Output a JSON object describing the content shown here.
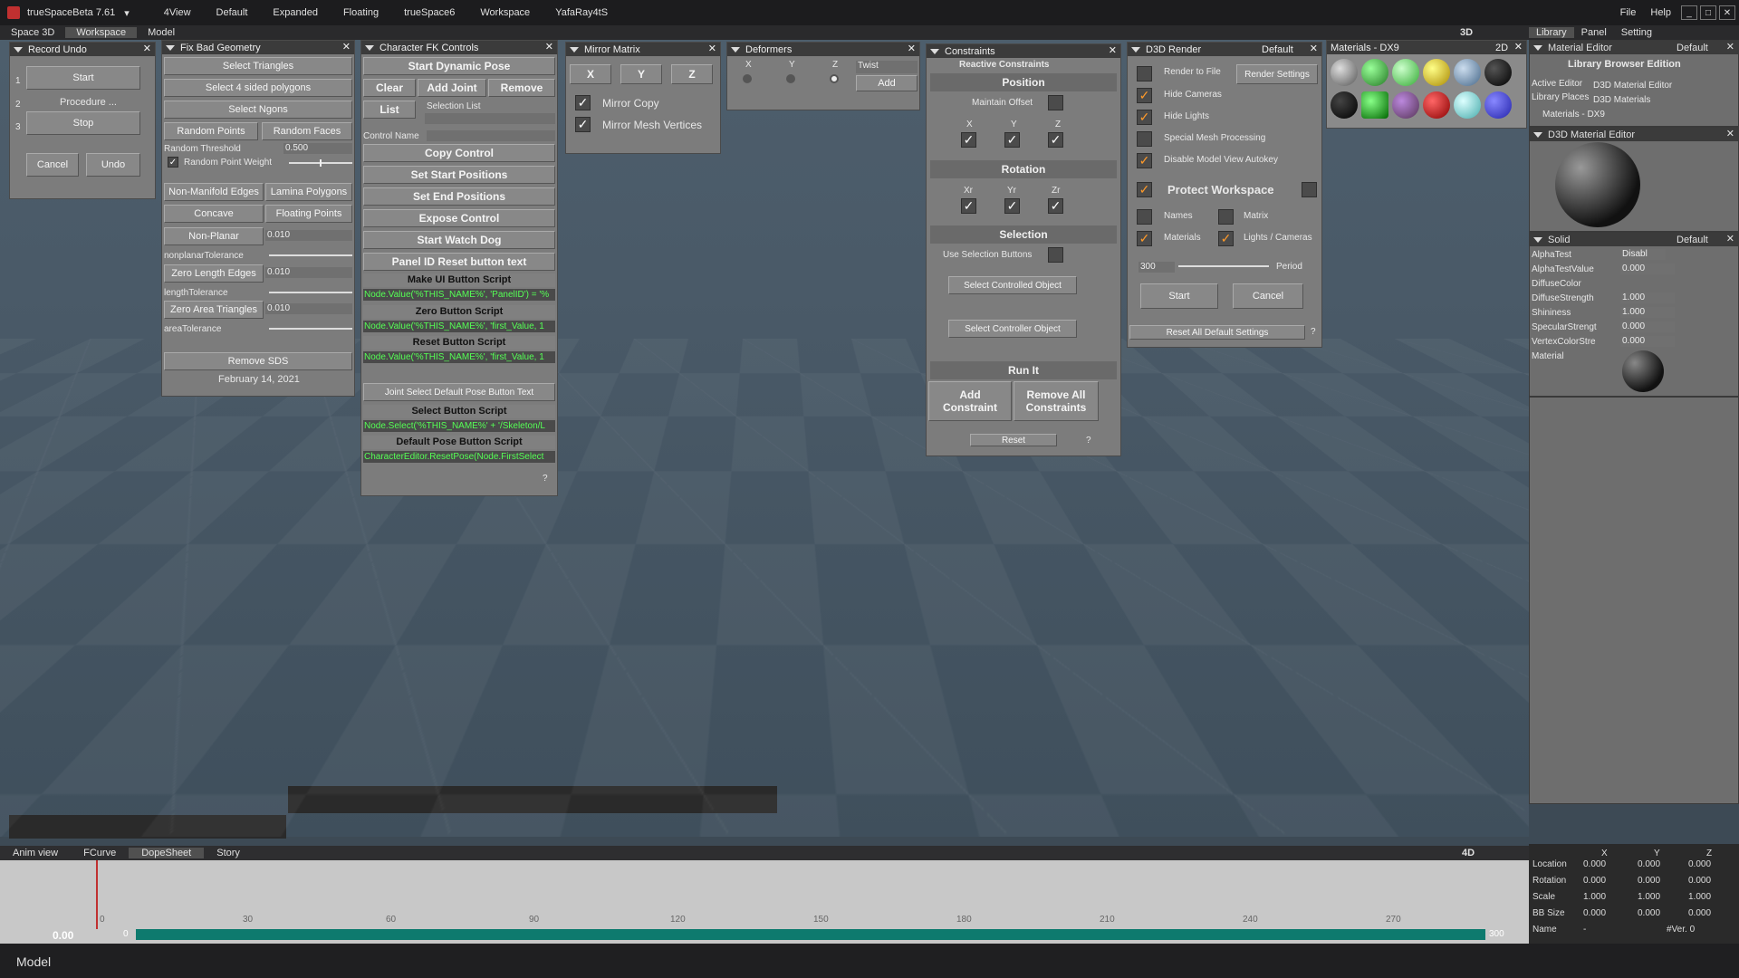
{
  "app": {
    "title": "trueSpaceBeta 7.61",
    "menu": [
      "4View",
      "Default",
      "Expanded",
      "Floating",
      "trueSpace6",
      "Workspace",
      "YafaRay4tS"
    ],
    "right_menu": [
      "File",
      "Help"
    ]
  },
  "tabs": [
    "Space 3D",
    "Workspace",
    "Model"
  ],
  "right_tabs": [
    "Library",
    "Panel",
    "Setting"
  ],
  "record_undo": {
    "title": "Record Undo",
    "start": "Start",
    "procedure": "Procedure ...",
    "stop": "Stop",
    "cancel": "Cancel",
    "undo": "Undo",
    "nums": [
      "1",
      "2",
      "3"
    ]
  },
  "fix_geom": {
    "title": "Fix Bad Geometry",
    "b1": "Select Triangles",
    "b2": "Select 4 sided polygons",
    "b3": "Select Ngons",
    "b4": "Random Points",
    "b5": "Random Faces",
    "thresh_label": "Random Threshold",
    "thresh_val": "0.500",
    "weight_label": "Random Point Weight",
    "b6": "Non-Manifold Edges",
    "b7": "Lamina Polygons",
    "b8": "Concave",
    "b9": "Floating Points",
    "b10": "Non-Planar",
    "np_val": "0.010",
    "np_tol": "nonplanarTolerance",
    "b11": "Zero Length Edges",
    "zl_val": "0.010",
    "len_tol": "lengthTolerance",
    "b12": "Zero Area Triangles",
    "za_val": "0.010",
    "area_tol": "areaTolerance",
    "b13": "Remove SDS",
    "date": "February 14, 2021"
  },
  "char_fk": {
    "title": "Character FK Controls",
    "start_pose": "Start Dynamic Pose",
    "clear": "Clear",
    "add": "Add Joint",
    "remove": "Remove",
    "list": "List",
    "sel_list": "Selection List",
    "control_name": "Control Name",
    "copy": "Copy Control",
    "set_start": "Set Start Positions",
    "set_end": "Set End Positions",
    "expose": "Expose Control",
    "watch": "Start Watch Dog",
    "panel_reset": "Panel ID Reset button text",
    "make_ui": "Make UI Button Script",
    "make_ui_code": "Node.Value('%THIS_NAME%', 'PanelID') = '%",
    "zero": "Zero Button Script",
    "zero_code": "Node.Value('%THIS_NAME%', 'first_Value, 1",
    "reset": "Reset Button Script",
    "reset_code": "Node.Value('%THIS_NAME%', 'first_Value, 1",
    "joint": "Joint Select Default Pose Button Text",
    "select": "Select Button Script",
    "select_code": "Node.Select('%THIS_NAME%' + '/Skeleton/L",
    "def_pose": "Default Pose Button Script",
    "def_code": "CharacterEditor.ResetPose(Node.FirstSelect",
    "q": "?"
  },
  "mirror": {
    "title": "Mirror Matrix",
    "x": "X",
    "y": "Y",
    "z": "Z",
    "copy": "Mirror Copy",
    "mesh": "Mirror Mesh Vertices"
  },
  "deformers": {
    "title": "Deformers",
    "x": "X",
    "y": "Y",
    "z": "Z",
    "mode": "Twist",
    "add": "Add"
  },
  "constraints": {
    "title": "Constraints",
    "sub": "Reactive Constraints",
    "position": "Position",
    "offset": "Maintain Offset",
    "x": "X",
    "y": "Y",
    "z": "Z",
    "rotation": "Rotation",
    "xr": "Xr",
    "yr": "Yr",
    "zr": "Zr",
    "selection": "Selection",
    "use_sel": "Use Selection Buttons",
    "sel_ctrl": "Select Controlled Object",
    "sel_ctrlr": "Select Controller Object",
    "run": "Run It",
    "add": "Add\nConstraint",
    "remove": "Remove All\nConstraints",
    "reset": "Reset",
    "q": "?"
  },
  "d3d": {
    "title": "D3D Render",
    "preset": "Default",
    "render": "Render to File",
    "settings": "Render Settings",
    "cams": "Hide Cameras",
    "lights": "Hide Lights",
    "mesh": "Special Mesh Processing",
    "autokey": "Disable Model View Autokey",
    "protect": "Protect Workspace",
    "names": "Names",
    "matrix": "Matrix",
    "materials": "Materials",
    "lights_cams": "Lights / Cameras",
    "period_val": "300",
    "period": "Period",
    "start": "Start",
    "cancel": "Cancel",
    "reset": "Reset All Default Settings",
    "q": "?"
  },
  "mat_panel": {
    "title": "Materials - DX9",
    "mode": "2D"
  },
  "mat_editor": {
    "title": "Material Editor",
    "preset": "Default",
    "browser": "Library Browser Edition",
    "active": "Active Editor",
    "active_val": "D3D Material Editor",
    "places": "Library Places",
    "places_val": "D3D Materials",
    "mats": "Materials - DX9"
  },
  "d3d_mat": {
    "title": "D3D Material Editor"
  },
  "solid": {
    "title": "Solid",
    "preset": "Default",
    "rows": [
      [
        "AlphaTest",
        "Disabl"
      ],
      [
        "AlphaTestValue",
        "0.000"
      ],
      [
        "DiffuseColor",
        ""
      ],
      [
        "DiffuseStrength",
        "1.000"
      ],
      [
        "Shininess",
        "1.000"
      ],
      [
        "SpecularStrengt",
        "0.000"
      ],
      [
        "VertexColorStre",
        "0.000"
      ],
      [
        "Material",
        ""
      ]
    ]
  },
  "anim": {
    "tabs": [
      "Anim view",
      "FCurve",
      "DopeSheet",
      "Story"
    ],
    "time": "0.00",
    "ticks": [
      "0",
      "30",
      "60",
      "90",
      "120",
      "150",
      "180",
      "210",
      "240",
      "270",
      "300"
    ],
    "start": "0",
    "end": "300",
    "mode": "4D"
  },
  "props": {
    "headers": [
      "X",
      "Y",
      "Z"
    ],
    "rows": [
      [
        "Location",
        "0.000",
        "0.000",
        "0.000"
      ],
      [
        "Rotation",
        "0.000",
        "0.000",
        "0.000"
      ],
      [
        "Scale",
        "1.000",
        "1.000",
        "1.000"
      ],
      [
        "BB Size",
        "0.000",
        "0.000",
        "0.000"
      ],
      [
        "Name",
        "-",
        "#Ver. 0",
        ""
      ]
    ]
  },
  "status": {
    "mode": "Model"
  },
  "viewport_mode": "3D",
  "colors": {
    "panel": "#7c7c7c",
    "header": "#3b3b3b",
    "green": "#55ff55",
    "orange": "#ff9a2a"
  }
}
